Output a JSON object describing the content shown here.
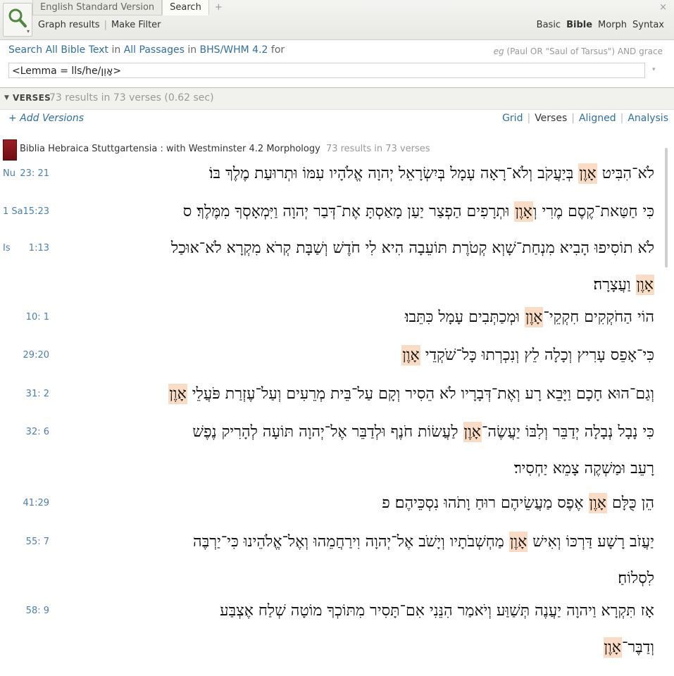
{
  "tabs": [
    "English Standard Version",
    "Search",
    "+"
  ],
  "toolbar": {
    "graph_results": "Graph results",
    "make_filter": "Make Filter",
    "modes": [
      "Basic",
      "Bible",
      "Morph",
      "Syntax"
    ],
    "selected_mode": "Bible"
  },
  "query": {
    "search_text": "Search",
    "all_bible_text": "All Bible Text",
    "in1": "in",
    "all_passages": "All Passages",
    "in2": "in",
    "version": "BHS/WHM 4.2",
    "for": "for",
    "input_value": "<Lemma = lls/he/אָוֶן>",
    "eg_prefix": "eg",
    "eg_text": "(Paul OR \"Saul of Tarsus\") AND grace"
  },
  "verses_header": {
    "label": "VERSES",
    "results": "73 results in 73 verses (0.62 sec)"
  },
  "add_versions": "+ Add Versions",
  "views": [
    "Grid",
    "Verses",
    "Aligned",
    "Analysis"
  ],
  "selected_view": "Verses",
  "book": {
    "title": "Biblia Hebraica Stuttgartensia : with Westminster 4.2 Morphology",
    "count": "73 results in 73 verses"
  },
  "verses": [
    {
      "book": "Nu",
      "ref": "23: 21",
      "lines": [
        [
          "לֹא־הִבִּיט ",
          "אָוֶן",
          " בְּיַעֲקֹב וְלֹא־רָאָה עָמָל בְּיִשְׂרָאֵל יְהוָה אֱלֹהָיו עִמּוֹ וּתְרוּעַת מֶלֶךְ בּוֹ׃"
        ]
      ]
    },
    {
      "book": "1 Sa",
      "ref": "15:23",
      "lines": [
        [
          "כִּי חַטַּאת־קֶסֶם מֶרִי וְ",
          "אָוֶן",
          " וּתְרָפִים הַפְצַר יַעַן מָאַסְתָּ אֶת־דְּבַר יְהוָה וַיִּמְאָסְךָ מִמֶּלֶךְ׃ ס"
        ]
      ]
    },
    {
      "book": "Is",
      "ref": "1:13",
      "lines": [
        [
          "לֹא תוֹסִיפוּ הָבִיא מִנְחַת־שָׁוְא קְטֹרֶת תּוֹעֵבָה הִיא לִי חֹדֶשׁ וְשַׁבָּת קְרֹא מִקְרָא לֹא־אוּכַל",
          "",
          ""
        ],
        [
          "",
          "אָוֶן",
          " וַעֲצָרָה׃"
        ]
      ]
    },
    {
      "book": "",
      "ref": "10: 1",
      "lines": [
        [
          "הוֹי הַחֹקְקִים חִקְקֵי־",
          "אָוֶן",
          " וּמְכַתְּבִים עָמָל כִּתֵּבוּ׃"
        ]
      ]
    },
    {
      "book": "",
      "ref": "29:20",
      "lines": [
        [
          "כִּי־אָפֵס עָרִיץ וְכָלָה לֵץ וְנִכְרְתוּ כָּל־שֹׁקְדֵי ",
          "אָוֶן",
          "׃"
        ]
      ]
    },
    {
      "book": "",
      "ref": "31: 2",
      "lines": [
        [
          "וְגַם־הוּא חָכָם וַיָּבֵא רָע וְאֶת־דְּבָרָיו לֹא הֵסִיר וְקָם עַל־בֵּית מְרֵעִים וְעַל־עֶזְרַת פֹּעֲלֵי ",
          "אָוֶן",
          "׃"
        ]
      ]
    },
    {
      "book": "",
      "ref": "32: 6",
      "lines": [
        [
          "כִּי נָבָל נְבָלָה יְדַבֵּר וְלִבּוֹ יַעֲשֶׂה־",
          "אָוֶן",
          " לַעֲשׂוֹת חֹנֶף וּלְדַבֵּר אֶל־יְהוָה תּוֹעָה לְהָרִיק נֶפֶשׁ"
        ],
        [
          "רָעֵב וּמַשְׁקֶה צָמֵא יַחְסִיר׃",
          "",
          ""
        ]
      ]
    },
    {
      "book": "",
      "ref": "41:29",
      "lines": [
        [
          "הֵן כֻּלָּם ",
          "אָוֶן",
          " אֶפֶס מַעֲשֵׂיהֶם רוּחַ וָתֹהוּ נִסְכֵּיהֶם׃ פ"
        ]
      ]
    },
    {
      "book": "",
      "ref": "55: 7",
      "lines": [
        [
          "יַעֲזֹב רָשָׁע דַּרְכּוֹ וְאִישׁ ",
          "אָוֶן",
          " מַחְשְׁבֹתָיו וְיָשֹׁב אֶל־יְהוָה וִירַחֲמֵהוּ וְאֶל־אֱלֹהֵינוּ כִּי־יַרְבֶּה"
        ],
        [
          "לִסְלוֹחַ׃",
          "",
          ""
        ]
      ]
    },
    {
      "book": "",
      "ref": "58: 9",
      "lines": [
        [
          "אָז תִּקְרָא וַיהוָה יַעֲנֶה תְּשַׁוַּע וְיֹאמַר הִנֵּנִי אִם־תָּסִיר מִתּוֹכְךָ מוֹטָה שְׁלַח אֶצְבַּע",
          "",
          ""
        ],
        [
          "וְדַבֶּר־",
          "אָוֶן",
          "׃"
        ]
      ]
    }
  ],
  "colors": {
    "link": "#2d6fa8",
    "ref": "#4a7fb0",
    "highlight": "#f9dcc3",
    "book": "#8b1a1f"
  }
}
